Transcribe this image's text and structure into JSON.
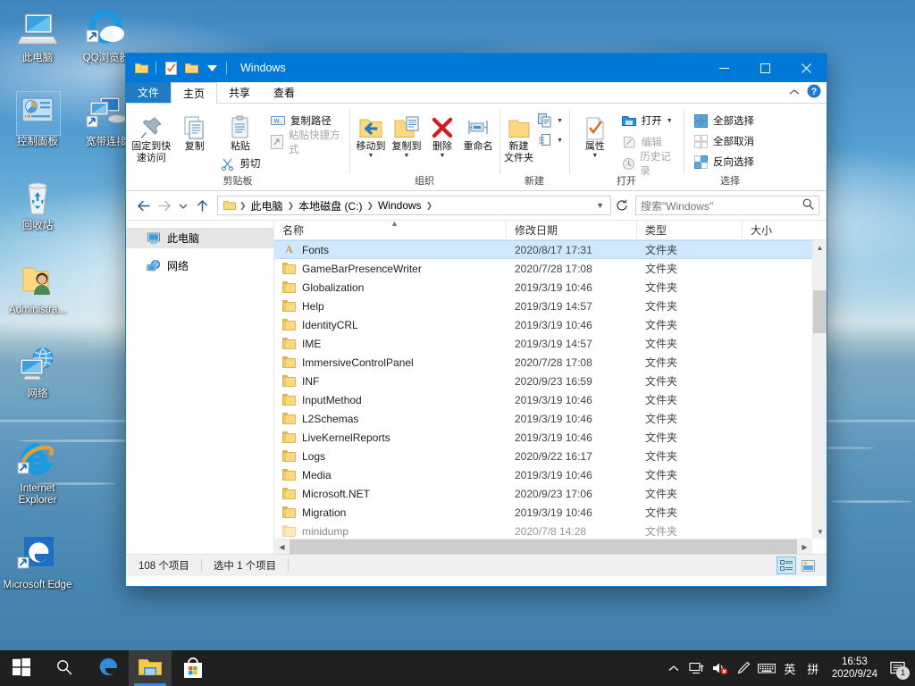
{
  "desktop": {
    "icons": [
      {
        "label": "此电脑",
        "icon": "computer-icon",
        "selected": false
      },
      {
        "label": "QQ浏览器",
        "icon": "qq-browser-icon",
        "selected": false
      },
      {
        "label": "控制面板",
        "icon": "control-panel-icon",
        "selected": true
      },
      {
        "label": "宽带连接",
        "icon": "broadband-connection-icon",
        "selected": false
      },
      {
        "label": "回收站",
        "icon": "recycle-bin-icon",
        "selected": false
      },
      {
        "label": "Administra...",
        "icon": "user-folder-icon",
        "selected": false
      },
      {
        "label": "网络",
        "icon": "network-icon",
        "selected": false
      },
      {
        "label": "Internet Explorer",
        "icon": "internet-explorer-icon",
        "selected": false
      },
      {
        "label": "Microsoft Edge",
        "icon": "microsoft-edge-icon",
        "selected": false
      }
    ]
  },
  "window": {
    "title": "Windows",
    "quick_access": [
      "folder-icon",
      "properties-icon",
      "new-folder-icon",
      "chevron-down-icon"
    ],
    "controls": {
      "minimize": "–",
      "maximize": "☐",
      "close": "✕"
    }
  },
  "tabs": [
    {
      "label": "文件",
      "type": "file"
    },
    {
      "label": "主页",
      "type": "active"
    },
    {
      "label": "共享",
      "type": "normal"
    },
    {
      "label": "查看",
      "type": "normal"
    }
  ],
  "ribbon": {
    "collapse_icon": "chevron-up-icon",
    "help_icon": "help-icon",
    "groups": [
      {
        "name": "剪贴板",
        "big": [
          {
            "label": "固定到快速访问",
            "icon": "pin-icon",
            "label_lines": [
              "固定到快",
              "速访问"
            ]
          },
          {
            "label": "复制",
            "icon": "copy-icon",
            "label_lines": [
              "复制"
            ]
          },
          {
            "label": "粘贴",
            "icon": "paste-icon",
            "label_lines": [
              "粘贴"
            ]
          }
        ],
        "small_under_paste": {
          "label": "剪切",
          "icon": "scissors-icon"
        },
        "small": [
          {
            "label": "复制路径",
            "icon": "copy-path-icon",
            "disabled": false
          },
          {
            "label": "粘贴快捷方式",
            "icon": "paste-shortcut-icon",
            "disabled": true
          }
        ]
      },
      {
        "name": "组织",
        "big": [
          {
            "label": "移动到",
            "icon": "move-to-icon",
            "has_caret": true
          },
          {
            "label": "复制到",
            "icon": "copy-to-icon",
            "has_caret": true
          },
          {
            "label": "删除",
            "icon": "delete-icon",
            "has_caret": true
          },
          {
            "label": "重命名",
            "icon": "rename-icon",
            "has_caret": false
          }
        ]
      },
      {
        "name": "新建",
        "big": [
          {
            "label": "新建文件夹",
            "icon": "new-folder-icon",
            "label_lines": [
              "新建",
              "文件夹"
            ]
          }
        ],
        "small": [
          {
            "label": "",
            "icon": "new-item-icon",
            "has_caret": true
          },
          {
            "label": "",
            "icon": "easy-access-icon",
            "has_caret": true
          }
        ]
      },
      {
        "name": "打开",
        "big": [
          {
            "label": "属性",
            "icon": "properties-icon",
            "has_caret": true
          }
        ],
        "small": [
          {
            "label": "打开",
            "icon": "open-icon",
            "disabled": false,
            "has_caret": true
          },
          {
            "label": "编辑",
            "icon": "edit-icon",
            "disabled": true
          },
          {
            "label": "历史记录",
            "icon": "history-icon",
            "disabled": true
          }
        ]
      },
      {
        "name": "选择",
        "small": [
          {
            "label": "全部选择",
            "icon": "select-all-icon",
            "disabled": false
          },
          {
            "label": "全部取消",
            "icon": "select-none-icon",
            "disabled": true
          },
          {
            "label": "反向选择",
            "icon": "invert-selection-icon",
            "disabled": false
          }
        ]
      }
    ]
  },
  "addressbar": {
    "back_icon": "arrow-left-icon",
    "forward_icon": "arrow-right-icon",
    "recent_icon": "chevron-down-icon",
    "up_icon": "arrow-up-icon",
    "breadcrumbs": [
      "此电脑",
      "本地磁盘 (C:)",
      "Windows"
    ],
    "refresh_icon": "refresh-icon",
    "search_placeholder": "搜索\"Windows\"",
    "search_icon": "search-icon"
  },
  "navpane": {
    "items": [
      {
        "label": "此电脑",
        "icon": "computer-icon",
        "selected": true
      },
      {
        "label": "网络",
        "icon": "network-icon",
        "selected": false
      }
    ]
  },
  "filelist": {
    "columns": [
      "名称",
      "修改日期",
      "类型",
      "大小"
    ],
    "sort_indicator": "▲",
    "rows": [
      {
        "name": "Fonts",
        "date": "2020/8/17 17:31",
        "type": "文件夹",
        "size": "",
        "icon": "fonts-folder-icon",
        "selected": true
      },
      {
        "name": "GameBarPresenceWriter",
        "date": "2020/7/28 17:08",
        "type": "文件夹",
        "size": "",
        "icon": "folder-icon",
        "selected": false
      },
      {
        "name": "Globalization",
        "date": "2019/3/19 10:46",
        "type": "文件夹",
        "size": "",
        "icon": "folder-icon",
        "selected": false
      },
      {
        "name": "Help",
        "date": "2019/3/19 14:57",
        "type": "文件夹",
        "size": "",
        "icon": "folder-icon",
        "selected": false
      },
      {
        "name": "IdentityCRL",
        "date": "2019/3/19 10:46",
        "type": "文件夹",
        "size": "",
        "icon": "folder-icon",
        "selected": false
      },
      {
        "name": "IME",
        "date": "2019/3/19 14:57",
        "type": "文件夹",
        "size": "",
        "icon": "folder-icon",
        "selected": false
      },
      {
        "name": "ImmersiveControlPanel",
        "date": "2020/7/28 17:08",
        "type": "文件夹",
        "size": "",
        "icon": "folder-icon",
        "selected": false
      },
      {
        "name": "INF",
        "date": "2020/9/23 16:59",
        "type": "文件夹",
        "size": "",
        "icon": "folder-icon",
        "selected": false
      },
      {
        "name": "InputMethod",
        "date": "2019/3/19 10:46",
        "type": "文件夹",
        "size": "",
        "icon": "folder-icon",
        "selected": false
      },
      {
        "name": "L2Schemas",
        "date": "2019/3/19 10:46",
        "type": "文件夹",
        "size": "",
        "icon": "folder-icon",
        "selected": false
      },
      {
        "name": "LiveKernelReports",
        "date": "2019/3/19 10:46",
        "type": "文件夹",
        "size": "",
        "icon": "folder-icon",
        "selected": false
      },
      {
        "name": "Logs",
        "date": "2020/9/22 16:17",
        "type": "文件夹",
        "size": "",
        "icon": "folder-icon",
        "selected": false
      },
      {
        "name": "Media",
        "date": "2019/3/19 10:46",
        "type": "文件夹",
        "size": "",
        "icon": "folder-icon",
        "selected": false
      },
      {
        "name": "Microsoft.NET",
        "date": "2020/9/23 17:06",
        "type": "文件夹",
        "size": "",
        "icon": "folder-icon",
        "selected": false
      },
      {
        "name": "Migration",
        "date": "2019/3/19 10:46",
        "type": "文件夹",
        "size": "",
        "icon": "folder-icon",
        "selected": false
      },
      {
        "name": "minidump",
        "date": "2020/7/8 14:28",
        "type": "文件夹",
        "size": "",
        "icon": "folder-icon",
        "selected": false
      }
    ]
  },
  "statusbar": {
    "item_count": "108 个项目",
    "selection": "选中 1 个项目",
    "view_details_icon": "details-view-icon",
    "view_tiles_icon": "large-icons-view-icon"
  },
  "taskbar": {
    "buttons": [
      {
        "name": "start-button",
        "icon": "windows-logo-icon",
        "active": false
      },
      {
        "name": "search-button",
        "icon": "search-icon",
        "active": false
      },
      {
        "name": "edge-button",
        "icon": "microsoft-edge-icon",
        "active": false
      },
      {
        "name": "file-explorer-button",
        "icon": "folder-icon",
        "active": true
      },
      {
        "name": "store-button",
        "icon": "microsoft-store-icon",
        "active": false
      }
    ],
    "tray": [
      {
        "name": "show-hidden-icons",
        "glyph": "^"
      },
      {
        "name": "network-icon",
        "glyph": "network"
      },
      {
        "name": "volume-muted-icon",
        "glyph": "speaker-mute"
      },
      {
        "name": "pen-icon",
        "glyph": "pen"
      },
      {
        "name": "touch-keyboard-icon",
        "glyph": "keyboard"
      },
      {
        "name": "ime-mode-icon",
        "glyph": "英"
      },
      {
        "name": "ime-pinyin-icon",
        "glyph": "拼"
      }
    ],
    "clock": {
      "time": "16:53",
      "date": "2020/9/24"
    },
    "notification_badge": "1"
  }
}
